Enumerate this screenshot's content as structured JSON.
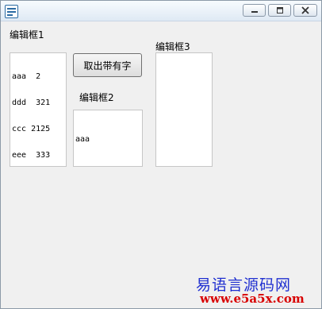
{
  "window": {
    "title": ""
  },
  "labels": {
    "edit1": "编辑框1",
    "edit2": "编辑框2",
    "edit3": "编辑框3"
  },
  "edit1": {
    "lines": [
      "aaa  2",
      "ddd  321",
      "ccc 2125",
      "eee  333"
    ]
  },
  "edit2": {
    "text": "aaa"
  },
  "edit3": {
    "text": ""
  },
  "button": {
    "label": "取出带有字"
  },
  "watermark": {
    "name": "易语言源码网",
    "url": "www.e5a5x.com"
  },
  "colors": {
    "watermark_name": "#1f2fd0",
    "watermark_url": "#d80000"
  },
  "icons": [
    "app-icon",
    "minimize-icon",
    "maximize-icon",
    "close-icon"
  ]
}
